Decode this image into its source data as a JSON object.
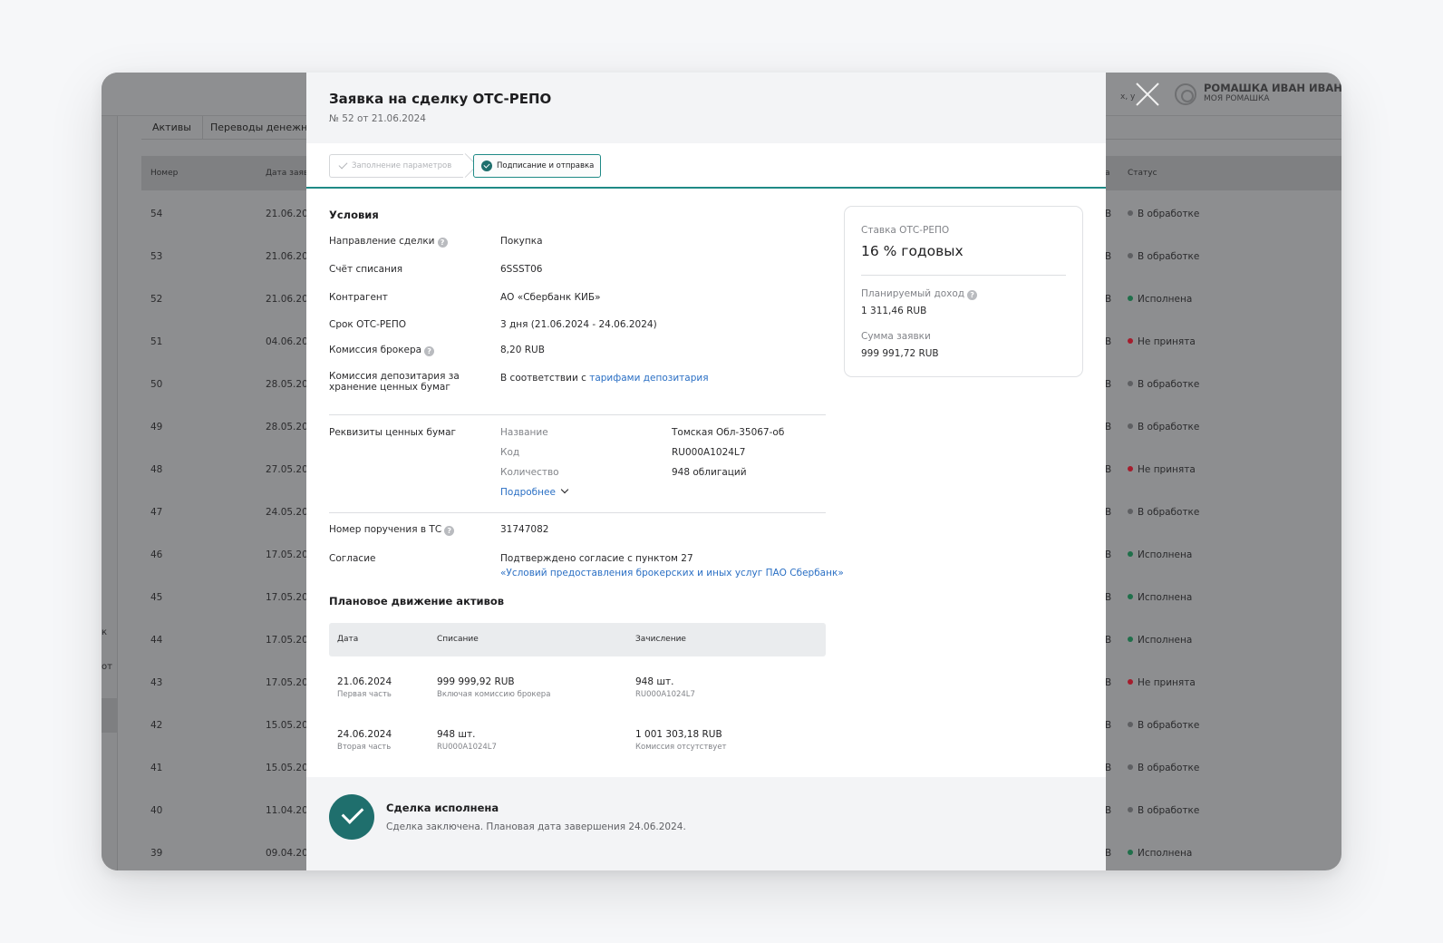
{
  "background": {
    "tabs": [
      "Активы",
      "Переводы денежных"
    ],
    "table_headers": {
      "number": "Номер",
      "date": "Дата заяв",
      "partial": "а",
      "status": "Статус"
    },
    "side_letters": [
      "к",
      "от"
    ],
    "user": {
      "name": "РОМАШКА ИВАН ИВАНОВИ",
      "org": "МОЯ РОМАШКА",
      "hint": "х, у"
    },
    "rows": [
      {
        "num": "54",
        "date": "21.06.20",
        "cur": "В",
        "status": "В обработке",
        "color": "#5e5f62"
      },
      {
        "num": "53",
        "date": "21.06.20",
        "cur": "В",
        "status": "В обработке",
        "color": "#5e5f62"
      },
      {
        "num": "52",
        "date": "21.06.20",
        "cur": "В",
        "status": "Исполнена",
        "color": "#1f6f4a"
      },
      {
        "num": "51",
        "date": "04.06.20",
        "cur": "В",
        "status": "Не принята",
        "color": "#a51c2c"
      },
      {
        "num": "50",
        "date": "28.05.20",
        "cur": "В",
        "status": "В обработке",
        "color": "#5e5f62"
      },
      {
        "num": "49",
        "date": "28.05.20",
        "cur": "В",
        "status": "В обработке",
        "color": "#5e5f62"
      },
      {
        "num": "48",
        "date": "27.05.20",
        "cur": "В",
        "status": "Не принята",
        "color": "#a51c2c"
      },
      {
        "num": "47",
        "date": "24.05.20",
        "cur": "В",
        "status": "В обработке",
        "color": "#5e5f62"
      },
      {
        "num": "46",
        "date": "17.05.20",
        "cur": "В",
        "status": "Исполнена",
        "color": "#1f6f4a"
      },
      {
        "num": "45",
        "date": "17.05.20",
        "cur": "В",
        "status": "Исполнена",
        "color": "#1f6f4a"
      },
      {
        "num": "44",
        "date": "17.05.20",
        "cur": "В",
        "status": "Исполнена",
        "color": "#1f6f4a"
      },
      {
        "num": "43",
        "date": "17.05.20",
        "cur": "В",
        "status": "Не принята",
        "color": "#a51c2c"
      },
      {
        "num": "42",
        "date": "15.05.20",
        "cur": "В",
        "status": "В обработке",
        "color": "#5e5f62"
      },
      {
        "num": "41",
        "date": "15.05.20",
        "cur": "В",
        "status": "В обработке",
        "color": "#5e5f62"
      },
      {
        "num": "40",
        "date": "11.04.20",
        "cur": "В",
        "status": "В обработке",
        "color": "#5e5f62"
      },
      {
        "num": "39",
        "date": "09.04.20",
        "cur": "В",
        "status": "Исполнена",
        "color": "#1f6f4a"
      }
    ]
  },
  "modal": {
    "title": "Заявка на сделку ОТС-РЕПО",
    "subtitle": "№ 52 от 21.06.2024",
    "steps": {
      "step1": "Заполнение параметров",
      "step2": "Подписание и отправка"
    },
    "conditions": {
      "title": "Условия",
      "direction_label": "Направление сделки",
      "direction_value": "Покупка",
      "account_label": "Счёт списания",
      "account_value": "6SSST06",
      "counterparty_label": "Контрагент",
      "counterparty_value": "АО «Сбербанк КИБ»",
      "term_label": "Срок ОТС-РЕПО",
      "term_value": "3 дня (21.06.2024 - 24.06.2024)",
      "broker_fee_label": "Комиссия брокера",
      "broker_fee_value": "8,20 RUB",
      "depo_fee_label_1": "Комиссия депозитария за",
      "depo_fee_label_2": "хранение ценных бумаг",
      "depo_fee_value_prefix": "В соответствии с ",
      "depo_fee_link": "тарифами депозитария"
    },
    "securities": {
      "label": "Реквизиты ценных бумаг",
      "name_label": "Название",
      "name_value": "Томская Обл-35067-об",
      "code_label": "Код",
      "code_value": "RU000A1024L7",
      "qty_label": "Количество",
      "qty_value": "948 облигаций",
      "more_link": "Подробнее"
    },
    "order": {
      "number_label": "Номер поручения в ТС",
      "number_value": "31747082",
      "consent_label": "Согласие",
      "consent_value": "Подтверждено согласие с пунктом 27",
      "consent_link": "«Условий предоставления брокерских и иных услуг ПАО Сбербанк»"
    },
    "movement": {
      "title": "Плановое движение активов",
      "headers": {
        "date": "Дата",
        "debit": "Списание",
        "credit": "Зачисление"
      },
      "rows": [
        {
          "date": "21.06.2024",
          "date_sub": "Первая часть",
          "debit": "999 999,92 RUB",
          "debit_sub": "Включая комиссию брокера",
          "credit": "948 шт.",
          "credit_sub": "RU000A1024L7"
        },
        {
          "date": "24.06.2024",
          "date_sub": "Вторая часть",
          "debit": "948 шт.",
          "debit_sub": "RU000A1024L7",
          "credit": "1 001 303,18 RUB",
          "credit_sub": "Комиссия отсутствует"
        }
      ]
    },
    "summary": {
      "rate_label": "Ставка ОТС-РЕПО",
      "rate_value": "16 % годовых",
      "income_label": "Планируемый доход",
      "income_value": "1 311,46 RUB",
      "amount_label": "Сумма заявки",
      "amount_value": "999 991,72 RUB"
    },
    "footer": {
      "title": "Сделка исполнена",
      "text": "Сделка заключена. Плановая дата завершения 24.06.2024."
    }
  }
}
